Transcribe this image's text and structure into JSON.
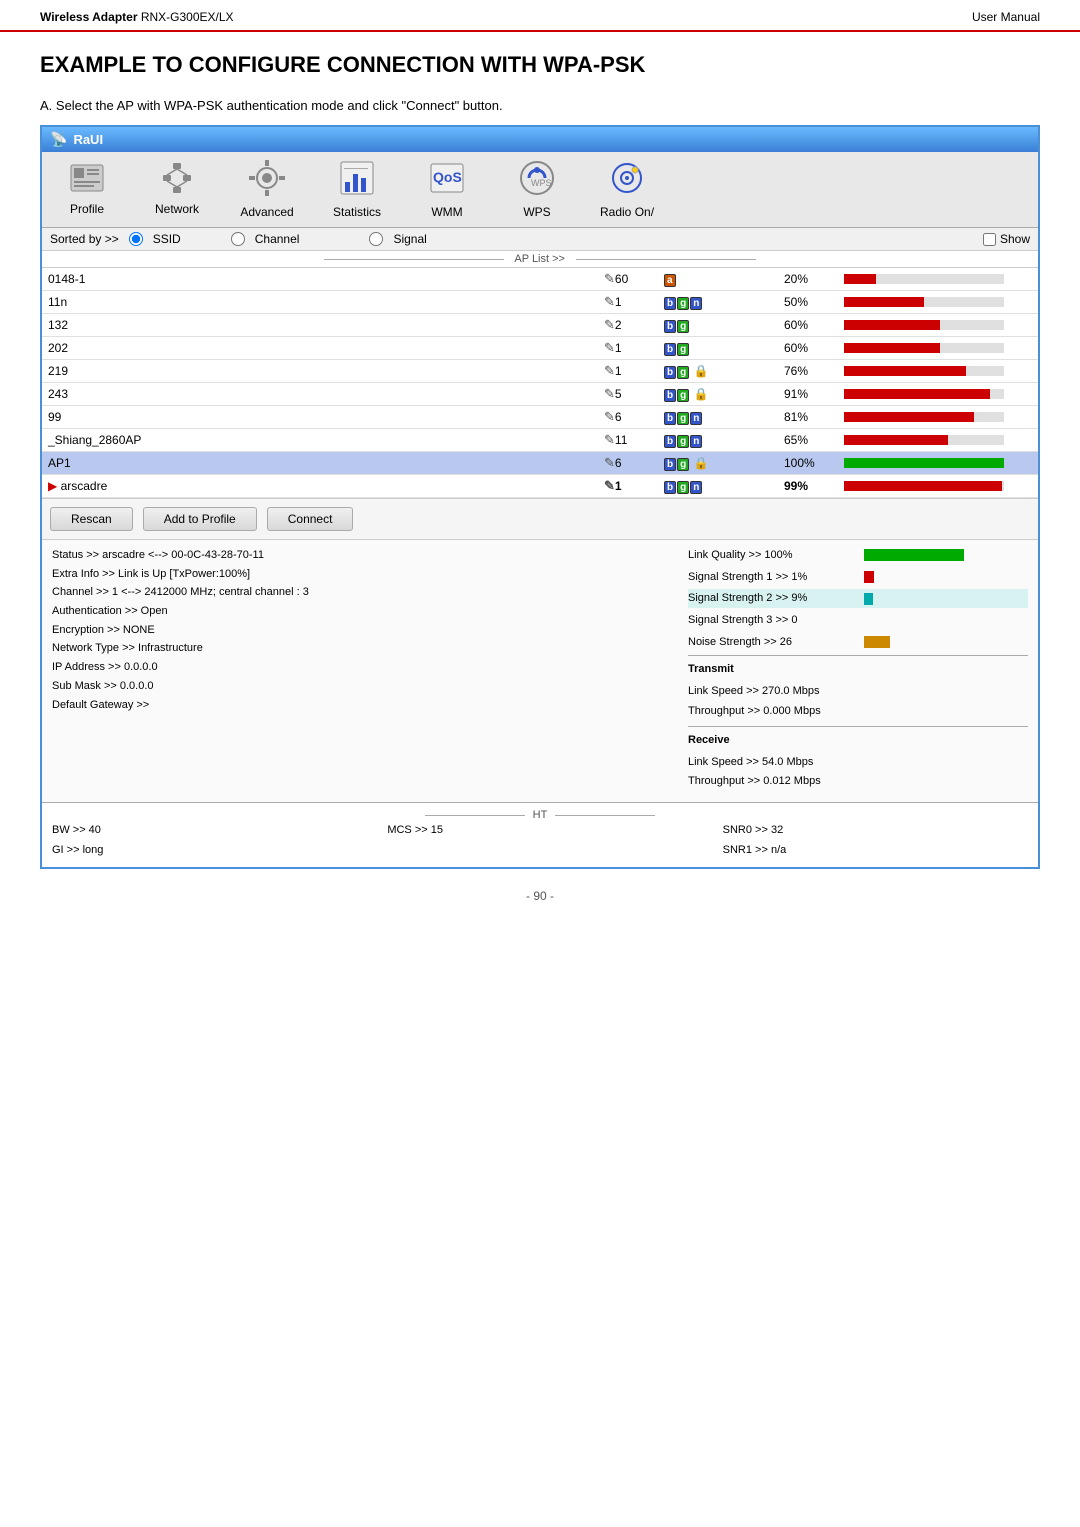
{
  "header": {
    "product": "Wireless Adapter",
    "model": "RNX-G300EX/LX",
    "manual": "User Manual"
  },
  "title": "EXAMPLE TO CONFIGURE CONNECTION WITH WPA-PSK",
  "subtitle": "A. Select the AP with WPA-PSK authentication mode and click \"Connect\" button.",
  "raui": {
    "title": "RaUI",
    "toolbar": {
      "items": [
        {
          "id": "profile",
          "label": "Profile",
          "icon": "🖥"
        },
        {
          "id": "network",
          "label": "Network",
          "icon": "🔗"
        },
        {
          "id": "advanced",
          "label": "Advanced",
          "icon": "⚙"
        },
        {
          "id": "statistics",
          "label": "Statistics",
          "icon": "📊"
        },
        {
          "id": "wmm",
          "label": "WMM",
          "icon": "📶"
        },
        {
          "id": "wps",
          "label": "WPS",
          "icon": "🔒"
        },
        {
          "id": "radio",
          "label": "Radio On/",
          "icon": "🔵"
        }
      ]
    },
    "sortbar": {
      "sorted_by": "Sorted by >>",
      "ssid_label": "SSID",
      "channel_label": "Channel",
      "signal_label": "Signal",
      "show_label": "Show"
    },
    "ap_list_header": "AP List >>",
    "ap_rows": [
      {
        "name": "0148-1",
        "channel": "60",
        "modes": [
          "a"
        ],
        "signal_pct": 20,
        "has_lock": false
      },
      {
        "name": "11n",
        "channel": "1",
        "modes": [
          "b",
          "g",
          "n"
        ],
        "signal_pct": 50,
        "has_lock": false
      },
      {
        "name": "132",
        "channel": "2",
        "modes": [
          "b",
          "g"
        ],
        "signal_pct": 60,
        "has_lock": false
      },
      {
        "name": "202",
        "channel": "1",
        "modes": [
          "b",
          "g"
        ],
        "signal_pct": 60,
        "has_lock": false
      },
      {
        "name": "219",
        "channel": "1",
        "modes": [
          "b",
          "g"
        ],
        "signal_pct": 76,
        "has_lock": true
      },
      {
        "name": "243",
        "channel": "5",
        "modes": [
          "b",
          "g"
        ],
        "signal_pct": 91,
        "has_lock": true
      },
      {
        "name": "99",
        "channel": "6",
        "modes": [
          "b",
          "g",
          "n"
        ],
        "signal_pct": 81,
        "has_lock": false
      },
      {
        "name": "_Shiang_2860AP",
        "channel": "11",
        "modes": [
          "b",
          "g",
          "n"
        ],
        "signal_pct": 65,
        "has_lock": false
      },
      {
        "name": "AP1",
        "channel": "6",
        "modes": [
          "b",
          "g"
        ],
        "signal_pct": 100,
        "has_lock": true,
        "selected": true
      },
      {
        "name": "arscadre",
        "channel": "1",
        "modes": [
          "b",
          "g",
          "n"
        ],
        "signal_pct": 99,
        "has_lock": false,
        "active": true
      }
    ],
    "buttons": {
      "rescan": "Rescan",
      "add_to_profile": "Add to Profile",
      "connect": "Connect"
    },
    "status": {
      "status_line": "Status >> arscadre <--> 00-0C-43-28-70-11",
      "extra_info": "Extra Info >> Link is Up [TxPower:100%]",
      "channel_line": "Channel >> 1 <--> 2412000 MHz; central channel : 3",
      "authentication": "Authentication >> Open",
      "encryption": "Encryption >> NONE",
      "network_type": "Network Type >> Infrastructure",
      "ip_address": "IP Address >> 0.0.0.0",
      "sub_mask": "Sub Mask >> 0.0.0.0",
      "default_gateway": "Default Gateway >>"
    },
    "ht": {
      "title": "HT",
      "bw": "BW >> 40",
      "gi": "GI >> long",
      "mcs": "MCS >> 15",
      "snr0": "SNR0 >> 32",
      "snr1": "SNR1 >> n/a"
    },
    "signal_meters": {
      "link_quality": {
        "label": "Link Quality >> 100%",
        "pct": 100,
        "color": "green"
      },
      "signal1": {
        "label": "Signal Strength 1 >> 1%",
        "pct": 10,
        "color": "red"
      },
      "signal2": {
        "label": "Signal Strength 2 >> 9%",
        "pct": 9,
        "color": "teal"
      },
      "signal3": {
        "label": "Signal Strength 3 >> 0",
        "pct": 0,
        "color": "orange"
      },
      "noise": {
        "label": "Noise Strength >> 26",
        "pct": 26,
        "color": "orange"
      }
    },
    "transmit": {
      "label": "Transmit",
      "link_speed": "Link Speed >> 270.0 Mbps",
      "throughput": "Throughput >> 0.000 Mbps"
    },
    "receive": {
      "label": "Receive",
      "link_speed": "Link Speed >> 54.0 Mbps",
      "throughput": "Throughput >> 0.012 Mbps"
    }
  },
  "footer": {
    "page": "- 90 -"
  }
}
